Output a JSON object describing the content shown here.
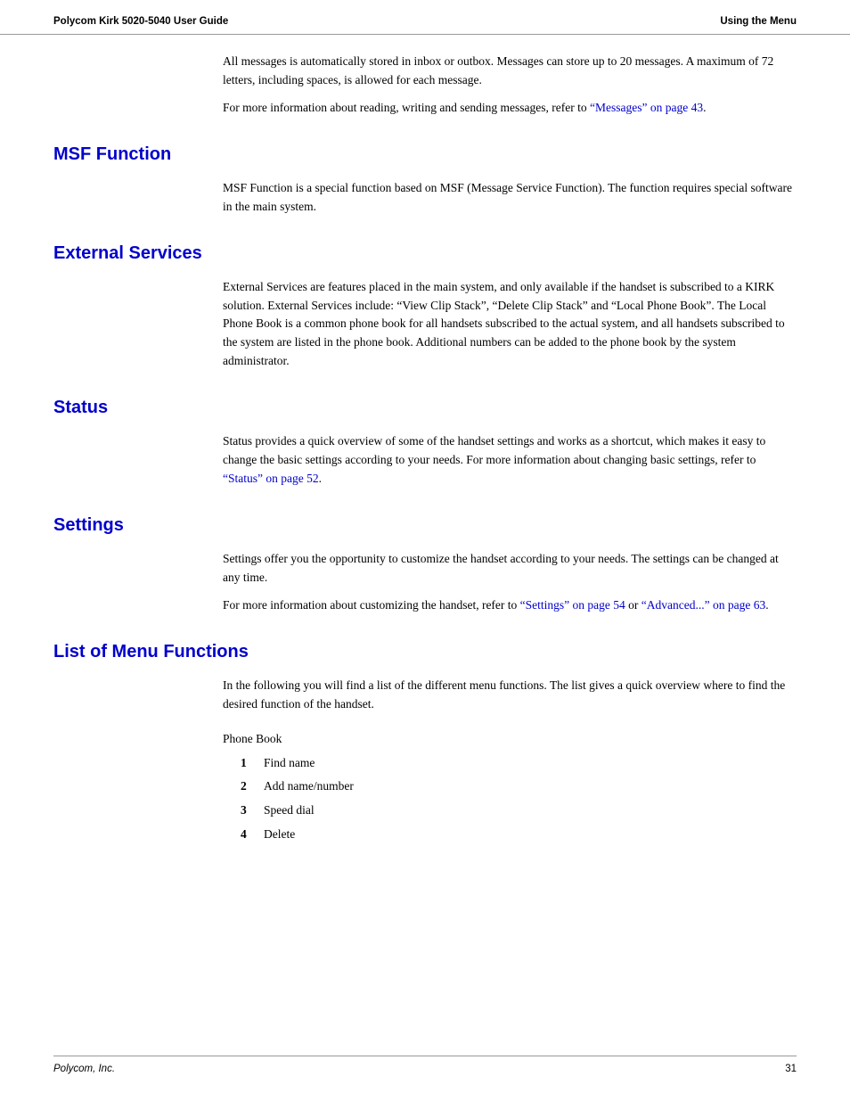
{
  "header": {
    "left": "Polycom Kirk 5020-5040 User Guide",
    "right": "Using the Menu"
  },
  "footer": {
    "left": "Polycom, Inc.",
    "right": "31"
  },
  "intro": {
    "para1": "All messages is automatically stored in inbox or outbox. Messages can store up to 20 messages. A maximum of 72 letters, including spaces, is allowed for each message.",
    "para2_start": "For more information about reading, writing and sending messages, refer to ",
    "para2_link": "“Messages” on page 43",
    "para2_end": "."
  },
  "sections": [
    {
      "id": "msf-function",
      "heading": "MSF Function",
      "paragraphs": [
        {
          "text": "MSF Function is a special function based on MSF (Message Service Function). The function requires special software in the main system.",
          "links": []
        }
      ]
    },
    {
      "id": "external-services",
      "heading": "External Services",
      "paragraphs": [
        {
          "text": "External Services are features placed in the main system, and only available if the handset is subscribed to a KIRK solution. External Services include: “View Clip Stack”, “Delete Clip Stack” and “Local Phone Book”. The Local Phone Book is a common phone book for all handsets subscribed to the actual system, and all handsets subscribed to the system are listed in the phone book. Additional numbers can be added to the phone book by the system administrator.",
          "links": []
        }
      ]
    },
    {
      "id": "status",
      "heading": "Status",
      "paragraphs": [
        {
          "text_start": "Status provides a quick overview of some of the handset settings and works as a shortcut, which makes it easy to change the basic settings according to your needs. For more information about changing basic settings, refer to ",
          "link": "“Status” on page 52",
          "text_end": ".",
          "links": [
            {
              "text": "“Status” on page 52",
              "href": "#"
            }
          ]
        }
      ]
    },
    {
      "id": "settings",
      "heading": "Settings",
      "paragraphs": [
        {
          "text": "Settings offer you the opportunity to customize the handset according to your needs. The settings can be changed at any time.",
          "links": []
        },
        {
          "text_start": "For more information about customizing the handset, refer to ",
          "link1": "“Settings” on page 54",
          "text_mid": " or ",
          "link2": "“Advanced...” on page 63",
          "text_end": ".",
          "links": [
            {
              "text": "“Settings” on page 54",
              "href": "#"
            },
            {
              "text": "“Advanced...” on page 63",
              "href": "#"
            }
          ]
        }
      ]
    }
  ],
  "list_section": {
    "heading": "List of Menu Functions",
    "intro_para1": "In the following you will find a list of the different menu functions. The list gives a quick overview where to find the desired function of the handset.",
    "phone_book_label": "Phone Book",
    "items": [
      {
        "num": "1",
        "text": "Find name"
      },
      {
        "num": "2",
        "text": "Add name/number"
      },
      {
        "num": "3",
        "text": "Speed dial"
      },
      {
        "num": "4",
        "text": "Delete"
      }
    ]
  }
}
